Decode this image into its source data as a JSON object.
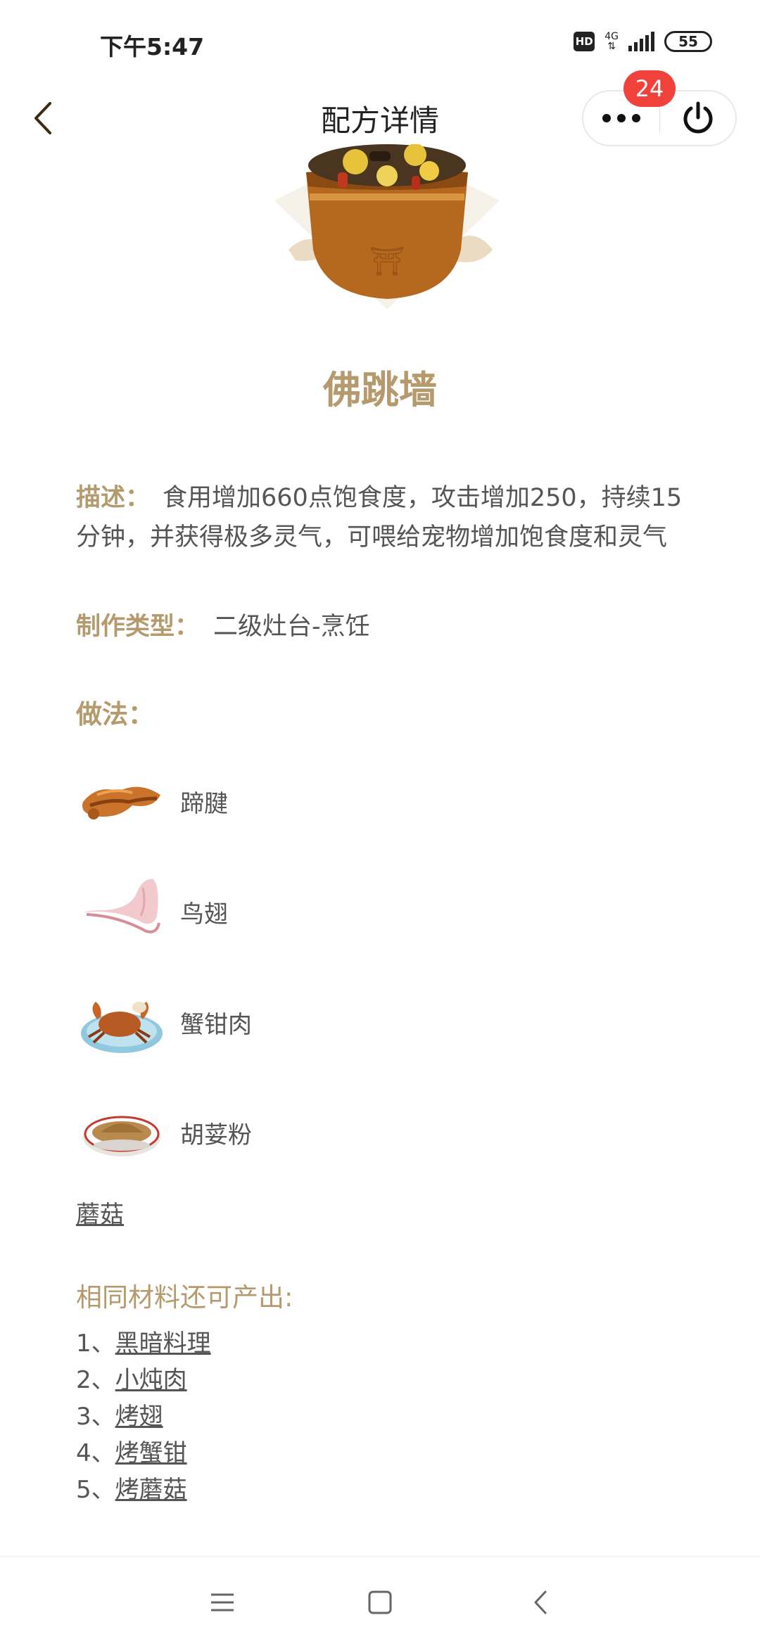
{
  "status_bar": {
    "time": "下午5:47",
    "hd": "HD",
    "network": "4G",
    "battery": "55"
  },
  "header": {
    "title": "配方详情",
    "badge_count": "24"
  },
  "dish": {
    "name": "佛跳墙",
    "description_label": "描述：",
    "description": "食用增加660点饱食度，攻击增加250，持续15分钟，并获得极多灵气，可喂给宠物增加饱食度和灵气",
    "type_label": "制作类型：",
    "type_value": "二级灶台-烹饪",
    "method_label": "做法："
  },
  "ingredients": [
    {
      "name": "蹄腱",
      "icon": "tendon-icon"
    },
    {
      "name": "鸟翅",
      "icon": "wing-icon"
    },
    {
      "name": "蟹钳肉",
      "icon": "crab-icon"
    },
    {
      "name": "胡荽粉",
      "icon": "spice-bowl-icon"
    }
  ],
  "extra_link": "蘑菇",
  "same_materials": {
    "title": "相同材料还可产出:",
    "items": [
      {
        "prefix": "1、",
        "name": "黑暗料理"
      },
      {
        "prefix": "2、",
        "name": "小炖肉"
      },
      {
        "prefix": "3、",
        "name": "烤翅"
      },
      {
        "prefix": "4、",
        "name": "烤蟹钳"
      },
      {
        "prefix": "5、",
        "name": "烤蘑菇"
      }
    ]
  },
  "colors": {
    "accent": "#b49a6c",
    "text": "#555555",
    "badge": "#f0423a"
  }
}
